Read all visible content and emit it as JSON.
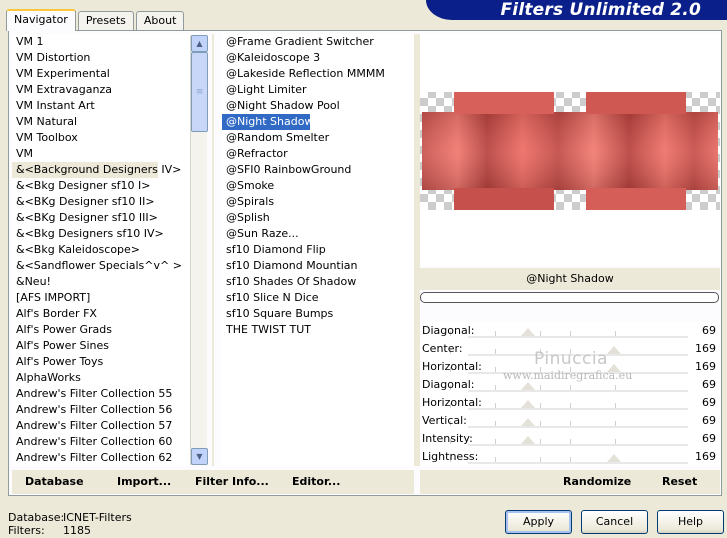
{
  "banner": {
    "title": "Filters Unlimited 2.0"
  },
  "tabs": [
    {
      "label": "Navigator",
      "active": true
    },
    {
      "label": "Presets"
    },
    {
      "label": "About"
    }
  ],
  "categories": [
    "VM 1",
    "VM Distortion",
    "VM Experimental",
    "VM Extravaganza",
    "VM Instant Art",
    "VM Natural",
    "VM Toolbox",
    "VM",
    "&<Background Designers IV>",
    "&<Bkg Designer sf10 I>",
    "&<BKg Designer sf10 II>",
    "&<BKg Designer sf10 III>",
    "&<Bkg Designers sf10 IV>",
    "&<Bkg Kaleidoscope>",
    "&<Sandflower Specials^v^ >",
    "&Neu!",
    "[AFS IMPORT]",
    "Alf's Border FX",
    "Alf's Power Grads",
    "Alf's Power Sines",
    "Alf's Power Toys",
    "AlphaWorks",
    "Andrew's Filter Collection 55",
    "Andrew's Filter Collection 56",
    "Andrew's Filter Collection 57",
    "Andrew's Filter Collection 60",
    "Andrew's Filter Collection 62"
  ],
  "selected_category": "&<Background Designers IV>",
  "filters": [
    "@Frame Gradient Switcher",
    "@Kaleidoscope 3",
    "@Lakeside Reflection MMMM",
    "@Light Limiter",
    "@Night Shadow Pool",
    "@Night Shadow",
    "@Random Smelter",
    "@Refractor",
    "@SFI0 RainbowGround",
    "@Smoke",
    "@Spirals",
    "@Splish",
    "@Sun Raze...",
    "sf10 Diamond Flip",
    "sf10 Diamond Mountian",
    "sf10 Shades Of Shadow",
    "sf10 Slice N Dice",
    "sf10 Square Bumps",
    "THE TWIST TUT"
  ],
  "selected_filter": "@Night Shadow",
  "preview": {
    "caption": "@Night Shadow",
    "accent": "#e8675f"
  },
  "params": [
    {
      "label": "Diagonal:",
      "value": "69"
    },
    {
      "label": "Center:",
      "value": "169"
    },
    {
      "label": "Horizontal:",
      "value": "169"
    },
    {
      "label": "Diagonal:",
      "value": "69"
    },
    {
      "label": "Horizontal:",
      "value": "69"
    },
    {
      "label": "Vertical:",
      "value": "69"
    },
    {
      "label": "Intensity:",
      "value": "69"
    },
    {
      "label": "Lightness:",
      "value": "169"
    }
  ],
  "watermark": {
    "line1": "Pinuccia",
    "line2": "www.maidiregrafica.eu"
  },
  "links": {
    "database": "Database",
    "import": "Import...",
    "filter_info": "Filter Info...",
    "editor": "Editor...",
    "randomize": "Randomize",
    "reset": "Reset"
  },
  "footer": {
    "database_label": "Database:",
    "database_value": "ICNET-Filters",
    "filters_label": "Filters:",
    "filters_value": "1185"
  },
  "buttons": {
    "apply": "Apply",
    "cancel": "Cancel",
    "help": "Help"
  }
}
